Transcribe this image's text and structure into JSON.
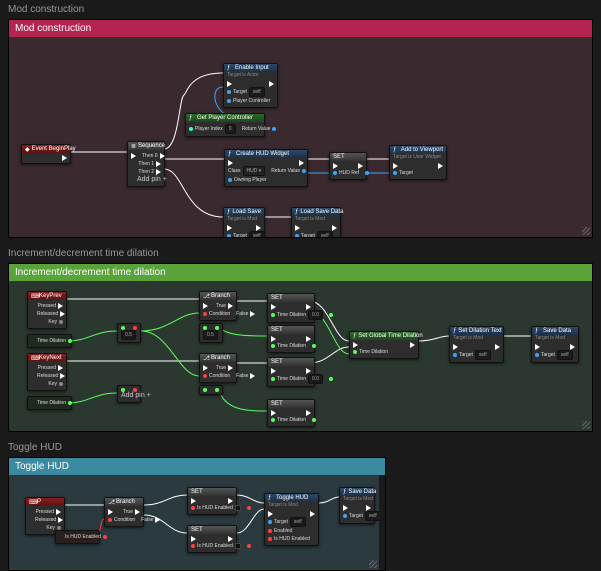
{
  "sections": {
    "mod_construction": {
      "label": "Mod construction",
      "header": "Mod construction"
    },
    "time_dilation": {
      "label": "Increment/decrement time dilation",
      "header": "Increment/decrement time dilation"
    },
    "toggle_hud": {
      "label": "Toggle HUD",
      "header": "Toggle HUD"
    }
  },
  "g1": {
    "event_begin_play": "Event BeginPlay",
    "sequence": {
      "title": "Sequence",
      "then0": "Then 0",
      "then1": "Then 1",
      "then2": "Then 2",
      "add_pin": "Add pin"
    },
    "enable_input": {
      "title": "Enable Input",
      "sub": "Target is Actor",
      "target": "Target",
      "self_val": "self",
      "player_controller": "Player Controller"
    },
    "get_player_controller": {
      "title": "Get Player Controller",
      "player_index": "Player Index",
      "player_index_val": "0",
      "return_value": "Return Value"
    },
    "create_widget": {
      "title": "Create HUD Widget",
      "class_label": "Class",
      "class_val": "HUD",
      "owning_player": "Owning Player",
      "return_value": "Return Value"
    },
    "set_hudref": {
      "title": "SET",
      "var": "HUD Ref"
    },
    "add_viewport": {
      "title": "Add to Viewport",
      "sub": "Target is User Widget",
      "target": "Target"
    },
    "load_save": {
      "title": "Load Save",
      "sub": "Target is Mod",
      "target": "Target",
      "self_val": "self"
    },
    "load_save_data": {
      "title": "Load Save Data",
      "sub": "Target is Mod",
      "target": "Target",
      "self_val": "self"
    }
  },
  "g2": {
    "key_prev": {
      "title": "KeyPrev",
      "pressed": "Pressed",
      "released": "Released",
      "key": "Key"
    },
    "key_next": {
      "title": "KeyNext",
      "pressed": "Pressed",
      "released": "Released",
      "key": "Key"
    },
    "branch": {
      "title": "Branch",
      "condition": "Condition",
      "true": "True",
      "false": "False"
    },
    "mult": {
      "op": "×",
      "val": "0.5"
    },
    "add_pin": "Add pin",
    "set_td": {
      "title": "SET",
      "var": "Time Dilation",
      "val": "0.0"
    },
    "get_td": "Time Dilation",
    "set_global": {
      "title": "Set Global Time Dilation",
      "time_dilation": "Time Dilation"
    },
    "set_td_text": {
      "title": "Set Dilation Text",
      "sub": "Target is Mod",
      "target": "Target",
      "self_val": "self"
    },
    "save_data": {
      "title": "Save Data",
      "sub": "Target is Mod",
      "target": "Target",
      "self_val": "self"
    }
  },
  "g3": {
    "key": {
      "title": "P",
      "pressed": "Pressed",
      "released": "Released",
      "key": "Key"
    },
    "branch": {
      "title": "Branch",
      "condition": "Condition",
      "true": "True",
      "false": "False"
    },
    "get_hud_enabled": "Is HUD Enabled",
    "set_hud": {
      "title": "SET",
      "var": "Is HUD Enabled"
    },
    "toggle_hud": {
      "title": "Toggle HUD",
      "sub": "Target is Mod",
      "target": "Target",
      "self_val": "self",
      "enabled": "Enabled",
      "enabled_src": "Is HUD Enabled"
    },
    "save_data": {
      "title": "Save Data",
      "sub": "Target is Mod",
      "target": "Target",
      "self_val": "self"
    }
  },
  "icons": {
    "plus": "+"
  }
}
